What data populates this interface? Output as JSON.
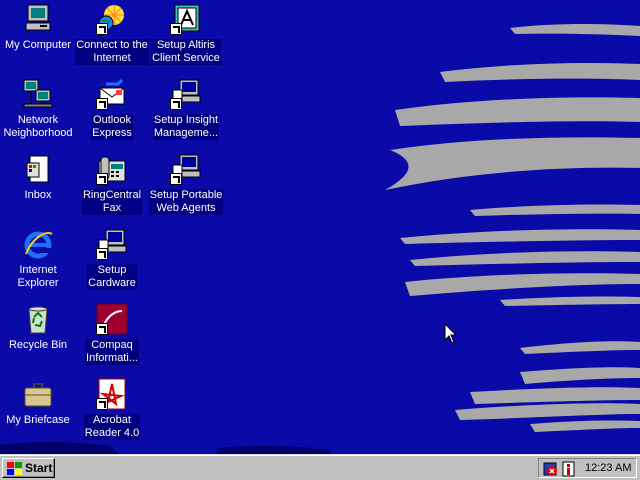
{
  "desktop": {
    "icons": [
      {
        "label": "My Computer",
        "icon": "my-computer-icon"
      },
      {
        "label": "Network\nNeighborhood",
        "icon": "network-neighborhood-icon"
      },
      {
        "label": "Inbox",
        "icon": "inbox-icon"
      },
      {
        "label": "Internet\nExplorer",
        "icon": "internet-explorer-icon"
      },
      {
        "label": "Recycle Bin",
        "icon": "recycle-bin-icon"
      },
      {
        "label": "My Briefcase",
        "icon": "briefcase-icon"
      },
      {
        "label": "Connect to the\nInternet",
        "icon": "connect-internet-icon"
      },
      {
        "label": "Outlook\nExpress",
        "icon": "outlook-express-icon"
      },
      {
        "label": "RingCentral\nFax",
        "icon": "fax-icon"
      },
      {
        "label": "Setup\nCardware",
        "icon": "setup-computer-icon"
      },
      {
        "label": "Compaq\nInformati...",
        "icon": "compaq-info-icon"
      },
      {
        "label": "Acrobat\nReader 4.0",
        "icon": "acrobat-icon"
      },
      {
        "label": "Setup Altiris\nClient Service",
        "icon": "altiris-icon"
      },
      {
        "label": "Setup Insight\nManageme...",
        "icon": "setup-computer-icon"
      },
      {
        "label": "Setup Portable\nWeb Agents",
        "icon": "setup-computer-icon"
      }
    ]
  },
  "taskbar": {
    "start_label": "Start",
    "clock": "12:23 AM",
    "tray_icons": [
      "security-tray-icon",
      "info-tray-icon"
    ]
  },
  "colors": {
    "desktop_bg": "#0a0aa8",
    "wallpaper_streak": "#a8a8a8",
    "taskbar": "#c0c0c0",
    "selection": "#000080"
  }
}
